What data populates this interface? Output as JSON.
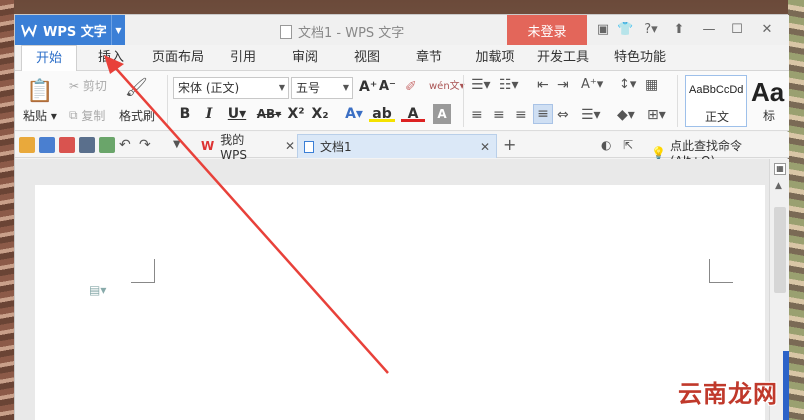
{
  "app": {
    "name": "WPS 文字",
    "doc_title": "文档1 - WPS 文字",
    "login": "未登录"
  },
  "tabs": [
    {
      "label": "开始",
      "active": true
    },
    {
      "label": "插入"
    },
    {
      "label": "页面布局"
    },
    {
      "label": "引用"
    },
    {
      "label": "审阅"
    },
    {
      "label": "视图"
    },
    {
      "label": "章节"
    },
    {
      "label": "加载项"
    },
    {
      "label": "开发工具"
    },
    {
      "label": "特色功能"
    }
  ],
  "ribbon": {
    "paste": "粘贴",
    "cut": "剪切",
    "copy": "复制",
    "format_painter": "格式刷",
    "font_name": "宋体 (正文)",
    "font_size": "五号",
    "style_sample": "AaBbCcDd",
    "style_normal": "正文",
    "style_heading_sample": "Aa",
    "style_heading": "标"
  },
  "quickbar": {
    "tabs": [
      {
        "label": "我的WPS"
      },
      {
        "label": "文档1",
        "active": true
      }
    ],
    "command": "点此查找命令 (Alt+Q)"
  },
  "watermark": "云南龙网",
  "colors": {
    "accent": "#3b7fd6",
    "login_bg": "#e3665a",
    "arrow": "#e8413a"
  }
}
